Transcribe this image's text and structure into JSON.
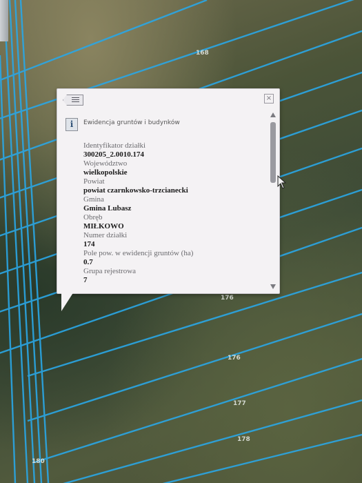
{
  "map": {
    "parcel_labels": [
      "168",
      "176",
      "176",
      "177",
      "178",
      "180"
    ]
  },
  "popup": {
    "layer_title": "Ewidencja gruntów i budynków",
    "close_symbol": "×",
    "info_symbol": "i",
    "attributes": [
      {
        "label": "Identyfikator działki",
        "value": "300205_2.0010.174"
      },
      {
        "label": "Województwo",
        "value": "wielkopolskie"
      },
      {
        "label": "Powiat",
        "value": "powiat czarnkowsko-trzcianecki"
      },
      {
        "label": "Gmina",
        "value": "Gmina Lubasz"
      },
      {
        "label": "Obręb",
        "value": "MIŁKOWO"
      },
      {
        "label": "Numer działki",
        "value": "174"
      },
      {
        "label": "Pole pow. w ewidencji gruntów (ha)",
        "value": "0.7"
      },
      {
        "label": "Grupa rejestrowa",
        "value": "7"
      }
    ]
  }
}
